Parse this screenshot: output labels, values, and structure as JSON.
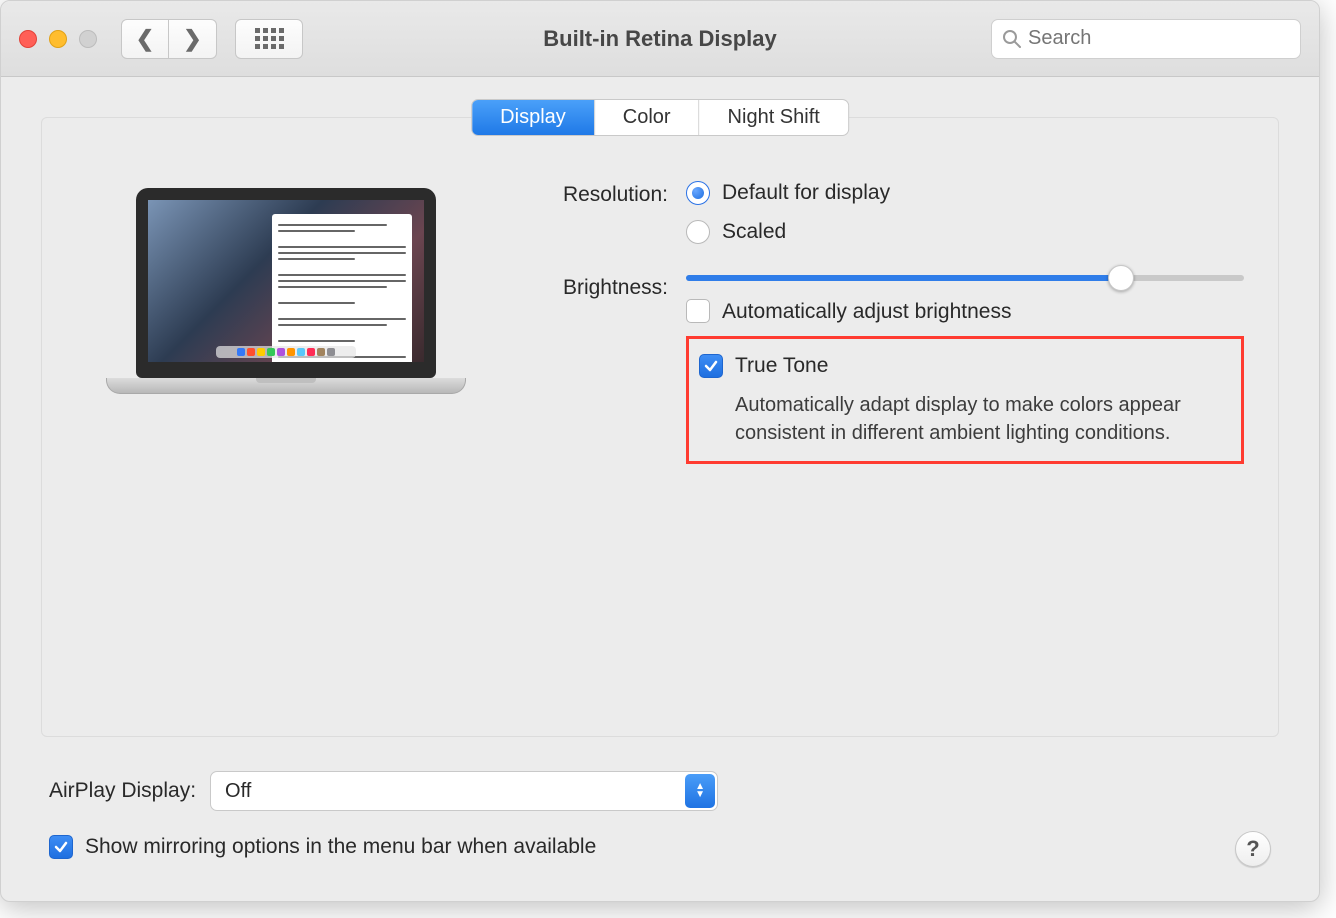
{
  "window": {
    "title": "Built-in Retina Display",
    "search_placeholder": "Search"
  },
  "tabs": {
    "display": "Display",
    "color": "Color",
    "night_shift": "Night Shift"
  },
  "labels": {
    "resolution": "Resolution:",
    "brightness": "Brightness:"
  },
  "resolution": {
    "default": "Default for display",
    "scaled": "Scaled"
  },
  "brightness_percent": 78,
  "auto_brightness_label": "Automatically adjust brightness",
  "true_tone": {
    "label": "True Tone",
    "desc": "Automatically adapt display to make colors appear consistent in different ambient lighting conditions."
  },
  "airplay": {
    "label": "AirPlay Display:",
    "value": "Off"
  },
  "mirroring_label": "Show mirroring options in the menu bar when available",
  "help": "?"
}
